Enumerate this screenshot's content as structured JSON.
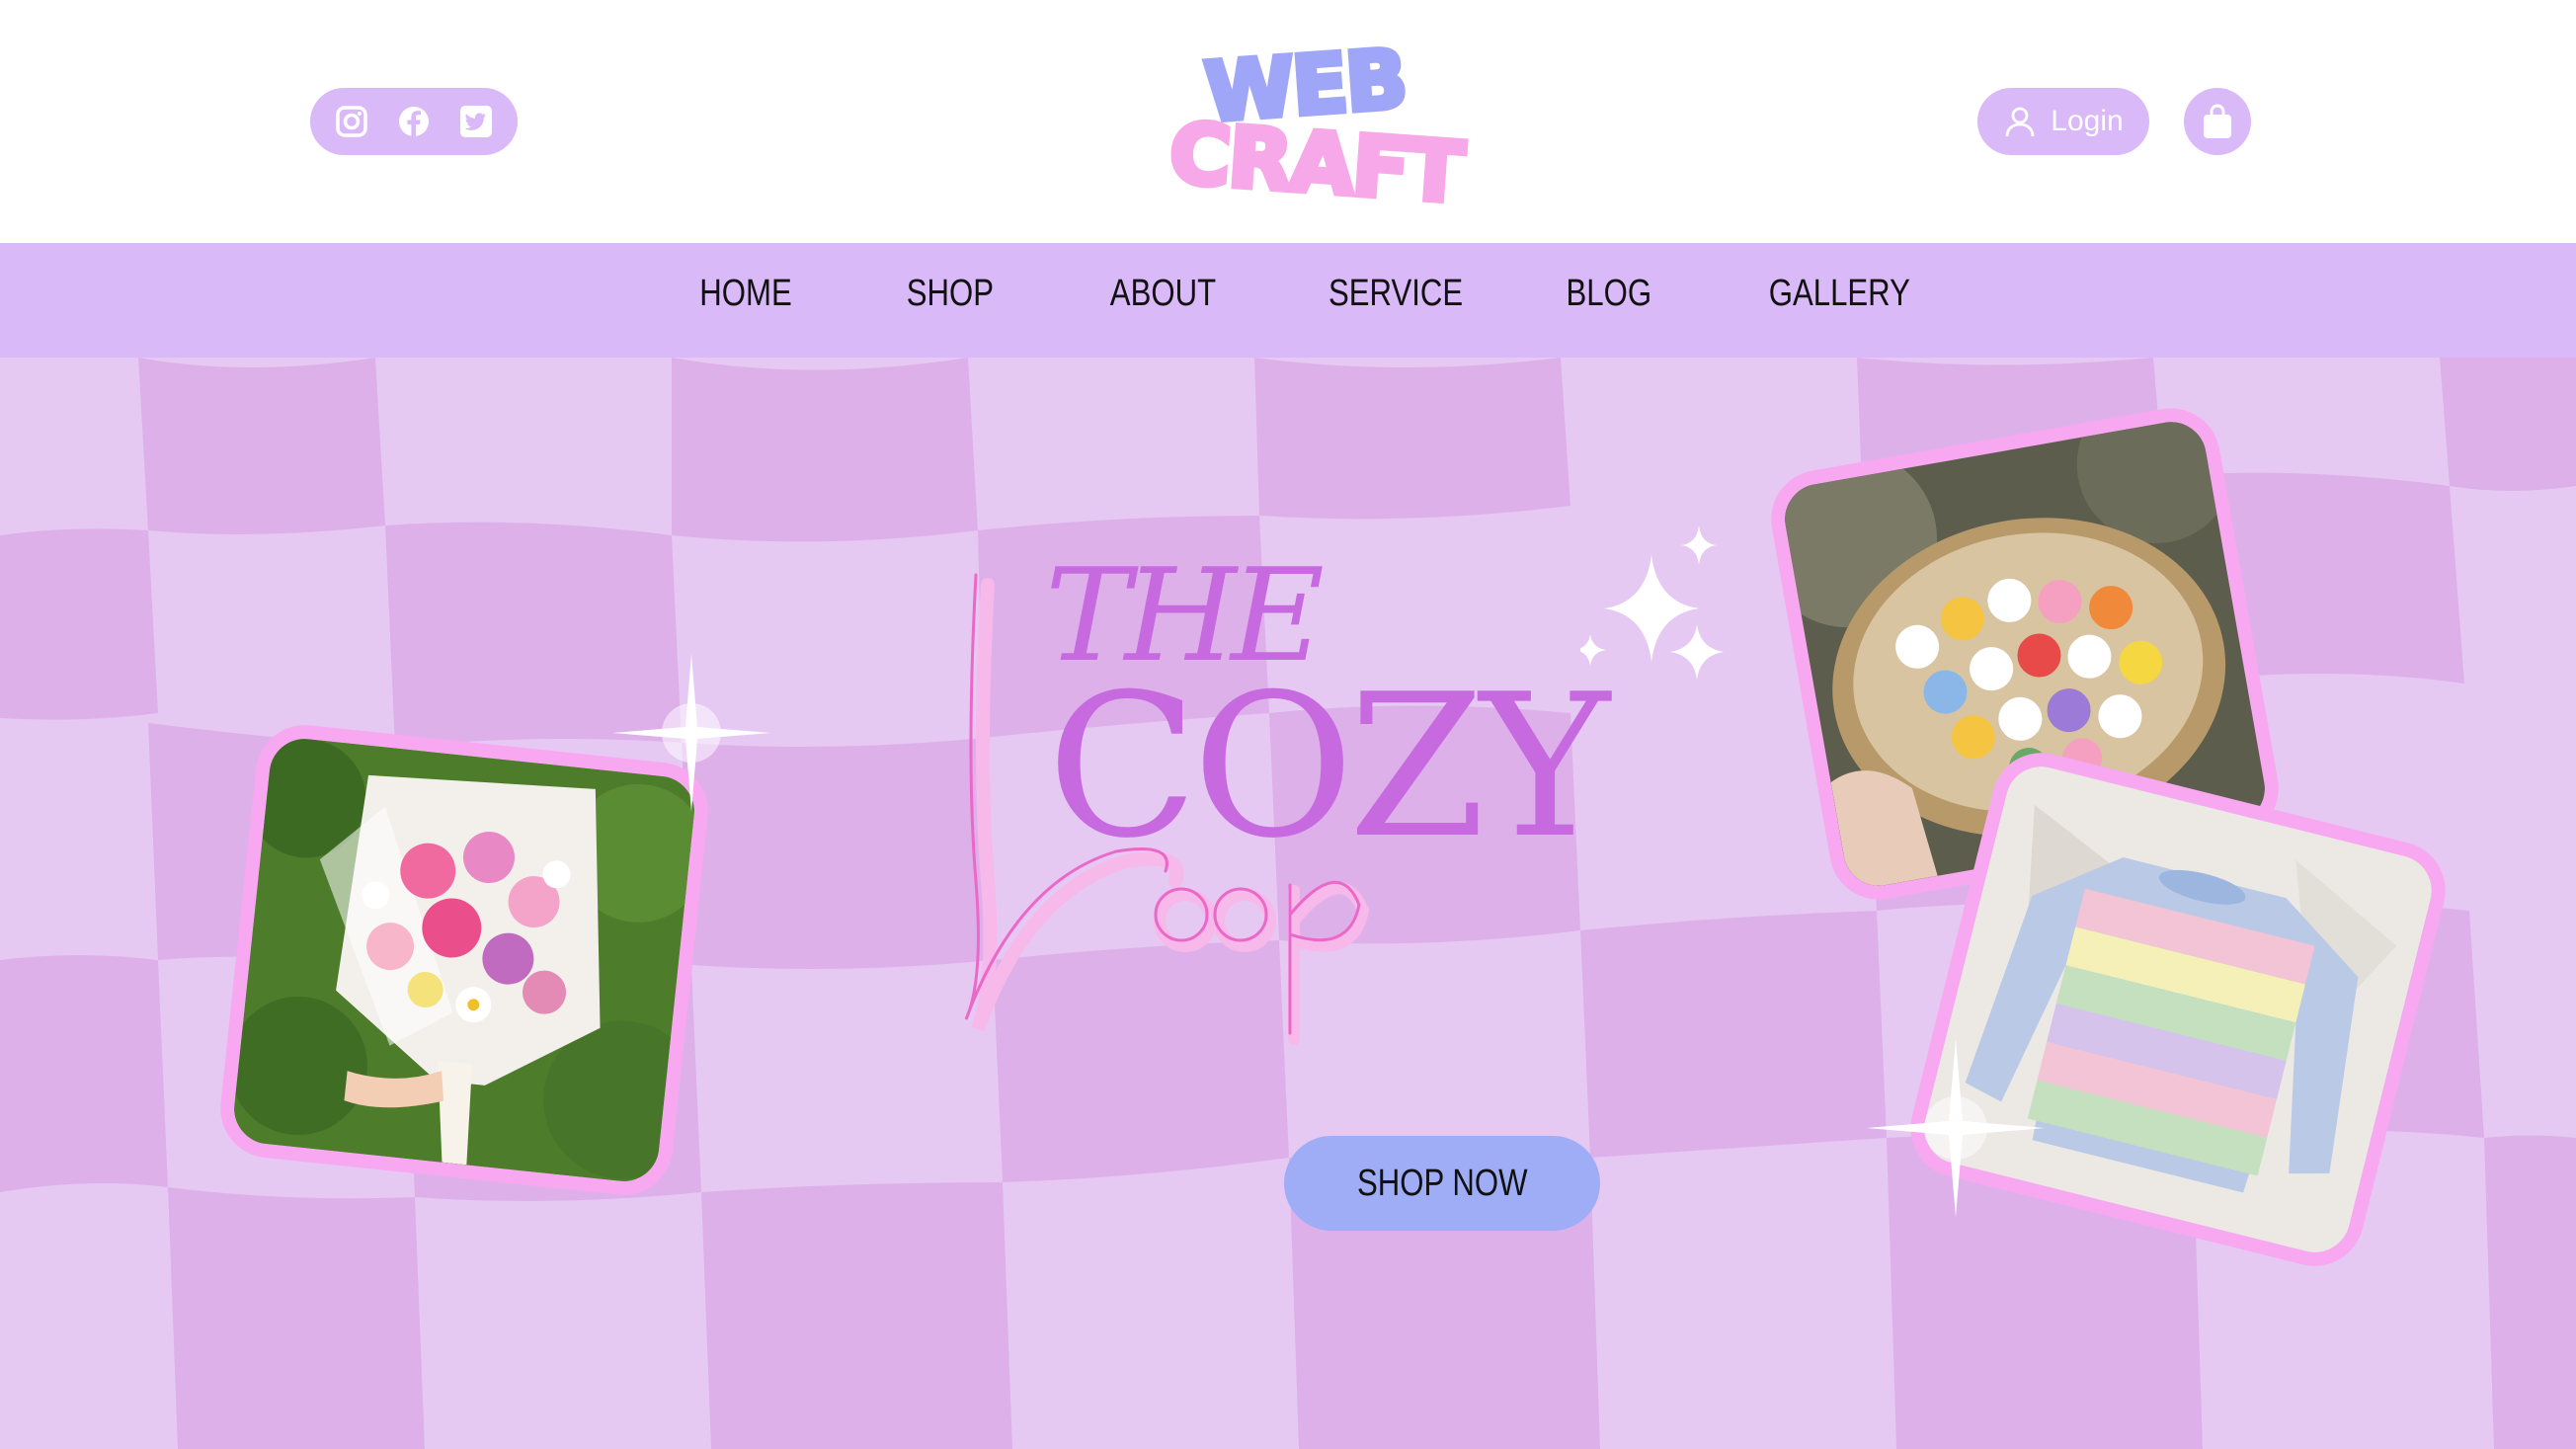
{
  "brand": {
    "logo_line1": "WEB",
    "logo_line2": "CRAFT"
  },
  "header": {
    "social_icons": [
      "instagram-icon",
      "facebook-icon",
      "twitter-icon"
    ],
    "login_label": "Login",
    "cart_icon": "shopping-bag-icon"
  },
  "nav": {
    "items": [
      "HOME",
      "SHOP",
      "ABOUT",
      "SERVICE",
      "BLOG",
      "GALLERY"
    ]
  },
  "hero": {
    "title_the": "THE",
    "title_cozy": "COZY",
    "title_loop": "Loop",
    "cta_label": "SHOP NOW",
    "photos": [
      "crochet-bouquet-photo",
      "crochet-toys-basket-photo",
      "crochet-sweater-photo"
    ]
  },
  "colors": {
    "lavender": "#d9b9f7",
    "checker_light": "#e6c9f2",
    "checker_dark": "#dfb2ea",
    "title_purple": "#c76ae0",
    "loop_pink": "#f7a8e8",
    "cta_blue": "#9fadf7",
    "logo_blue": "#9fa6f7",
    "logo_pink": "#f7a8e8"
  }
}
